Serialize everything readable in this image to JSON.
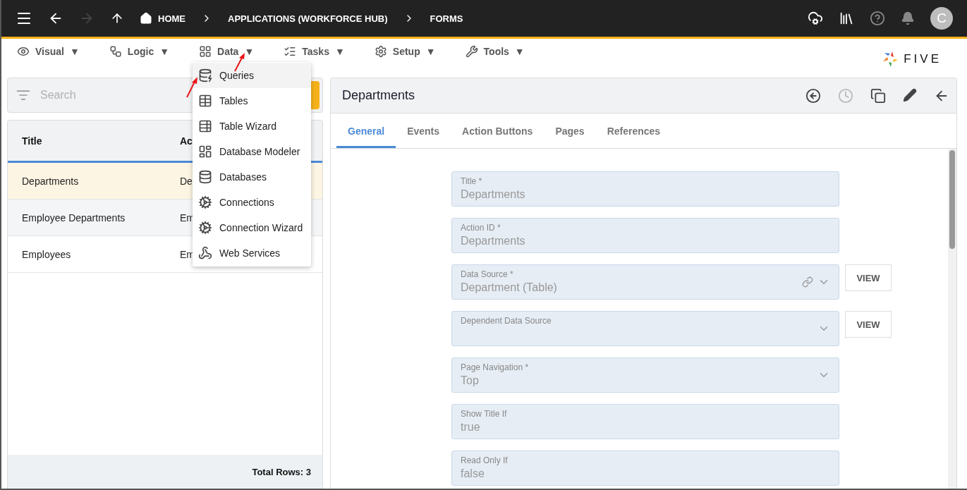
{
  "topbar": {
    "breadcrumbs": [
      "HOME",
      "APPLICATIONS (WORKFORCE HUB)",
      "FORMS"
    ],
    "forward_disabled": true,
    "avatar": "C"
  },
  "menubar": {
    "items": [
      {
        "label": "Visual"
      },
      {
        "label": "Logic"
      },
      {
        "label": "Data"
      },
      {
        "label": "Tasks"
      },
      {
        "label": "Setup"
      },
      {
        "label": "Tools"
      }
    ],
    "caret": "▼",
    "logo": "FIVE"
  },
  "dropdown": {
    "items": [
      {
        "label": "Queries",
        "selected": true
      },
      {
        "label": "Tables",
        "selected": false
      },
      {
        "label": "Table Wizard",
        "selected": false
      },
      {
        "label": "Database Modeler",
        "selected": false
      },
      {
        "label": "Databases",
        "selected": false
      },
      {
        "label": "Connections",
        "selected": false
      },
      {
        "label": "Connection Wizard",
        "selected": false
      },
      {
        "label": "Web Services",
        "selected": false
      }
    ]
  },
  "list": {
    "search": {
      "placeholder": "Search"
    },
    "columns": [
      "Title",
      "Ac"
    ],
    "rows": [
      {
        "cells": [
          "Departments",
          "De"
        ],
        "selected": true
      },
      {
        "cells": [
          "Employee Departments",
          "Em"
        ],
        "selected": false
      },
      {
        "cells": [
          "Employees",
          "Em"
        ],
        "selected": false
      }
    ],
    "total": "Total Rows: 3"
  },
  "detail": {
    "title": "Departments",
    "history_disabled": true,
    "tabs": [
      {
        "label": "General",
        "selected": true
      },
      {
        "label": "Events",
        "selected": false
      },
      {
        "label": "Action Buttons",
        "selected": false
      },
      {
        "label": "Pages",
        "selected": false
      },
      {
        "label": "References",
        "selected": false
      }
    ],
    "fields": [
      {
        "label": "Title *",
        "value": "Departments",
        "kind": "text"
      },
      {
        "label": "Action ID *",
        "value": "Departments",
        "kind": "text"
      },
      {
        "label": "Data Source *",
        "value": "Department (Table)",
        "kind": "select",
        "linked": true,
        "button": "VIEW"
      },
      {
        "label": "Dependent Data Source",
        "kind": "select",
        "button": "VIEW"
      },
      {
        "label": "Page Navigation *",
        "value": "Top",
        "kind": "select"
      },
      {
        "label": "Show Title If",
        "value": "true",
        "kind": "text"
      },
      {
        "label": "Read Only If",
        "value": "false",
        "kind": "text"
      }
    ]
  }
}
